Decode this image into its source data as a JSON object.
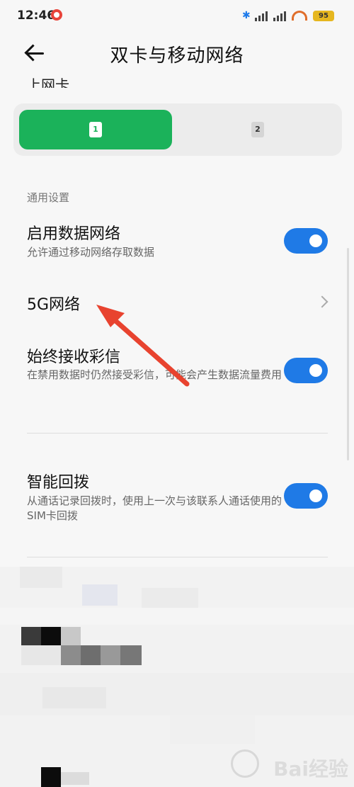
{
  "status_bar": {
    "time": "12:46",
    "battery": "95"
  },
  "header": {
    "title": "双卡与移动网络"
  },
  "data_sim": {
    "section_label": "上网卡",
    "options": [
      "1",
      "2"
    ]
  },
  "general": {
    "title": "通用设置",
    "items": [
      {
        "title": "启用数据网络",
        "subtitle": "允许通过移动网络存取数据",
        "enabled": true
      },
      {
        "title": "5G网络"
      },
      {
        "title": "始终接收彩信",
        "subtitle": "在禁用数据时仍然接受彩信，可能会产生数据流量费用",
        "enabled": true
      },
      {
        "title": "智能回拨",
        "subtitle": "从通话记录回拨时，使用上一次与该联系人通话使用的SIM卡回拨",
        "enabled": true
      }
    ]
  },
  "colors": {
    "accent": "#1f7ae6",
    "sim_selected": "#1bb25a",
    "annotation_arrow": "#e8432f"
  },
  "watermark": {
    "text": "Bai经验"
  }
}
